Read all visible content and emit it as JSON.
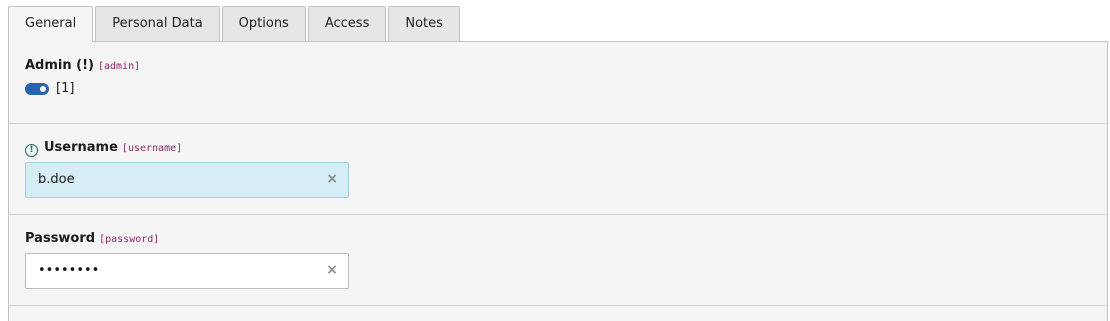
{
  "tabs": [
    {
      "label": "General",
      "active": true
    },
    {
      "label": "Personal Data",
      "active": false
    },
    {
      "label": "Options",
      "active": false
    },
    {
      "label": "Access",
      "active": false
    },
    {
      "label": "Notes",
      "active": false
    }
  ],
  "fields": {
    "admin": {
      "label": "Admin (!)",
      "fieldname": "[admin]",
      "toggle_on": true,
      "value_text": "[1]"
    },
    "username": {
      "label": "Username",
      "fieldname": "[username]",
      "value": "b.doe",
      "icon": "info-icon"
    },
    "password": {
      "label": "Password",
      "fieldname": "[password]",
      "value": "••••••••"
    }
  },
  "icons": {
    "clear": "×",
    "info": "!"
  },
  "colors": {
    "toggle_on": "#2664b0",
    "changed_field_bg": "#d5edf4",
    "fieldname": "#8c2a6a",
    "info_icon": "#1d6473"
  }
}
